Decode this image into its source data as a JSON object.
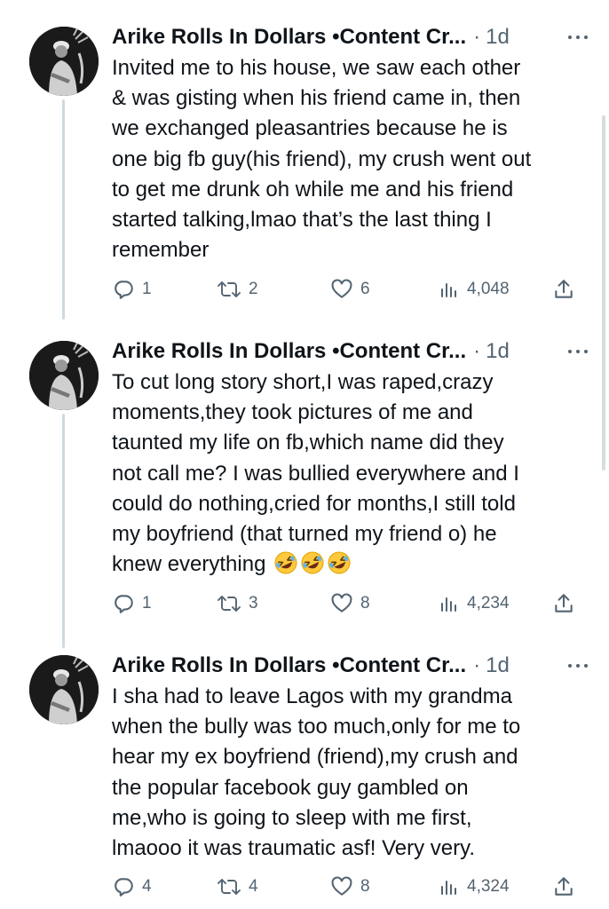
{
  "tweets": [
    {
      "author": "Arike Rolls In Dollars •Content Cr...",
      "separator": "·",
      "time": "1d",
      "text": "Invited me to his house, we saw each other\n& was gisting when his friend came in, then\nwe exchanged pleasantries because he is\none big fb guy(his friend), my crush went out\nto get me drunk oh while me and his friend\nstarted talking,lmao that’s the last thing I\nremember",
      "replies": "1",
      "retweets": "2",
      "likes": "6",
      "views": "4,048"
    },
    {
      "author": "Arike Rolls In Dollars •Content Cr...",
      "separator": "·",
      "time": "1d",
      "text": "To cut long story short,I was raped,crazy\nmoments,they took pictures of me and\ntaunted my life on fb,which name did they\nnot call me? I was bullied everywhere and I\ncould do nothing,cried for months,I still told\nmy boyfriend (that turned my friend o) he\nknew everything ",
      "emojis": [
        "rolling-on-floor-laughing",
        "rolling-on-floor-laughing",
        "rolling-on-floor-laughing"
      ],
      "replies": "1",
      "retweets": "3",
      "likes": "8",
      "views": "4,234"
    },
    {
      "author": "Arike Rolls In Dollars •Content Cr...",
      "separator": "·",
      "time": "1d",
      "text": "I sha had to leave Lagos with my grandma\nwhen the bully was too much,only for me to\nhear my ex boyfriend (friend),my crush and\nthe popular facebook guy gambled on\nme,who is going to sleep with me first,\nlmaooo it was traumatic asf! Very very.",
      "replies": "4",
      "retweets": "4",
      "likes": "8",
      "views": "4,324"
    }
  ],
  "colors": {
    "text": "#0f1419",
    "secondary": "#536471",
    "thread_line": "#cfd9de"
  },
  "icons": [
    "reply-icon",
    "retweet-icon",
    "like-icon",
    "views-icon",
    "share-icon",
    "more-icon"
  ]
}
